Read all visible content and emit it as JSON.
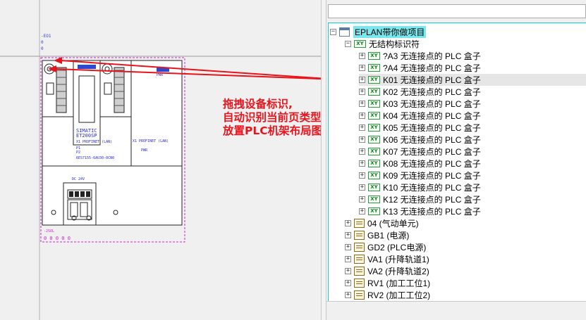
{
  "annotation": {
    "lines": [
      "拖拽设备标识,",
      "自动识别当前页类型,",
      "放置PLC机架布局图"
    ],
    "badge": "1",
    "color": "#e8141c"
  },
  "drawing": {
    "tag": "-EO1",
    "model": "SIMATIC",
    "model2": "ET200SP",
    "port1": "X1 PROFINET (LAN)",
    "port2": "X1 PROFINET (LAN)",
    "order": "6ES7155-6AU30-0CN0",
    "label_pwr": "PWR",
    "label_bottom": "-2SOL",
    "label_dc": "DC 24V"
  },
  "panel": {
    "filter_value": "",
    "tree": {
      "root": {
        "label": "EPLAN带你做项目",
        "expander": "−"
      },
      "group": {
        "label": "无结构标识符",
        "expander": "−",
        "tag": "XY"
      },
      "devices": [
        {
          "label": "?A3 无连接点的 PLC 盒子",
          "expander": "+",
          "tag": "XY"
        },
        {
          "label": "?A4 无连接点的 PLC 盒子",
          "expander": "+",
          "tag": "XY"
        },
        {
          "label": "K01 无连接点的 PLC 盒子",
          "expander": "+",
          "tag": "XY",
          "selected": true
        },
        {
          "label": "K02 无连接点的 PLC 盒子",
          "expander": "+",
          "tag": "XY"
        },
        {
          "label": "K03 无连接点的 PLC 盒子",
          "expander": "+",
          "tag": "XY"
        },
        {
          "label": "K04 无连接点的 PLC 盒子",
          "expander": "+",
          "tag": "XY"
        },
        {
          "label": "K05 无连接点的 PLC 盒子",
          "expander": "+",
          "tag": "XY"
        },
        {
          "label": "K06 无连接点的 PLC 盒子",
          "expander": "+",
          "tag": "XY"
        },
        {
          "label": "K07 无连接点的 PLC 盒子",
          "expander": "+",
          "tag": "XY"
        },
        {
          "label": "K08 无连接点的 PLC 盒子",
          "expander": "+",
          "tag": "XY"
        },
        {
          "label": "K09 无连接点的 PLC 盒子",
          "expander": "+",
          "tag": "XY"
        },
        {
          "label": "K10 无连接点的 PLC 盒子",
          "expander": "+",
          "tag": "XY"
        },
        {
          "label": "K12 无连接点的 PLC 盒子",
          "expander": "+",
          "tag": "XY"
        },
        {
          "label": "K13 无连接点的 PLC 盒子",
          "expander": "+",
          "tag": "XY"
        }
      ],
      "locations": [
        {
          "label": "04 (气动单元)",
          "expander": "+"
        },
        {
          "label": "GB1 (电源)",
          "expander": "+"
        },
        {
          "label": "GD2 (PLC电源)",
          "expander": "+"
        },
        {
          "label": "VA1 (升降轨道1)",
          "expander": "+"
        },
        {
          "label": "VA2 (升降轨道2)",
          "expander": "+"
        },
        {
          "label": "RV1 (加工工位1)",
          "expander": "+"
        },
        {
          "label": "RV2 (加工工位2)",
          "expander": "+"
        }
      ]
    }
  }
}
